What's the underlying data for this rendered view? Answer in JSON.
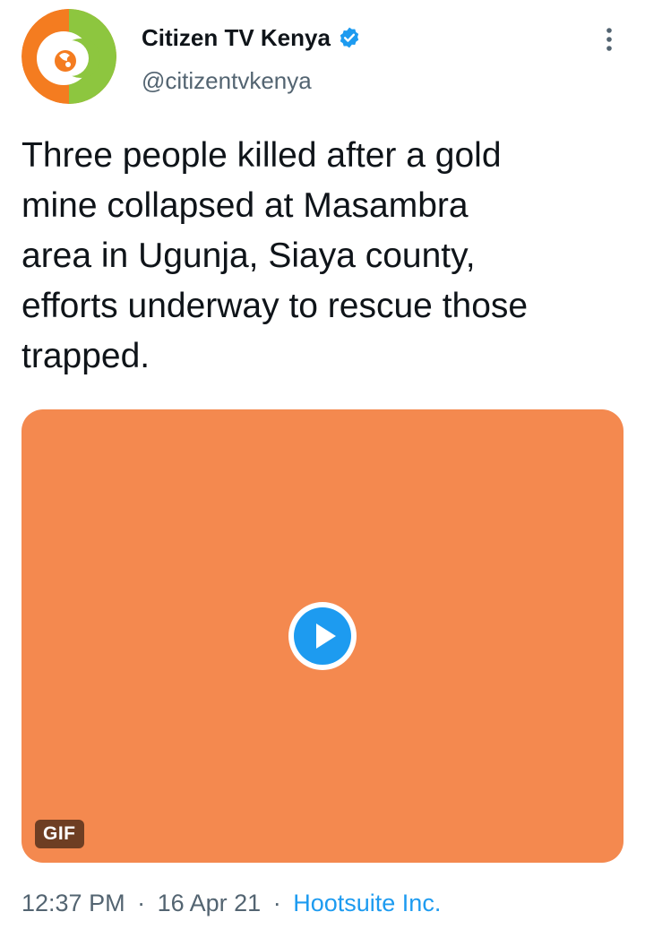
{
  "tweet": {
    "author": {
      "display_name": "Citizen TV Kenya",
      "handle": "@citizentvkenya",
      "verified": true,
      "avatar_colors": {
        "ring": "#f47c20",
        "accent": "#8dc63f",
        "inner": "#ffffff"
      }
    },
    "more_icon": "more-vertical-icon",
    "text": "Three people killed after a gold\nmine collapsed at Masambra\narea in Ugunja, Siaya county,\nefforts underway to rescue those\ntrapped.",
    "media": {
      "type": "gif",
      "badge": "GIF",
      "background": "#f4894f",
      "play_icon": "play-icon",
      "play_color": "#1d9bf0"
    },
    "meta": {
      "time": "12:37 PM",
      "separator": "·",
      "date": "16 Apr 21",
      "source": "Hootsuite Inc.",
      "source_color": "#1d9bf0"
    }
  }
}
